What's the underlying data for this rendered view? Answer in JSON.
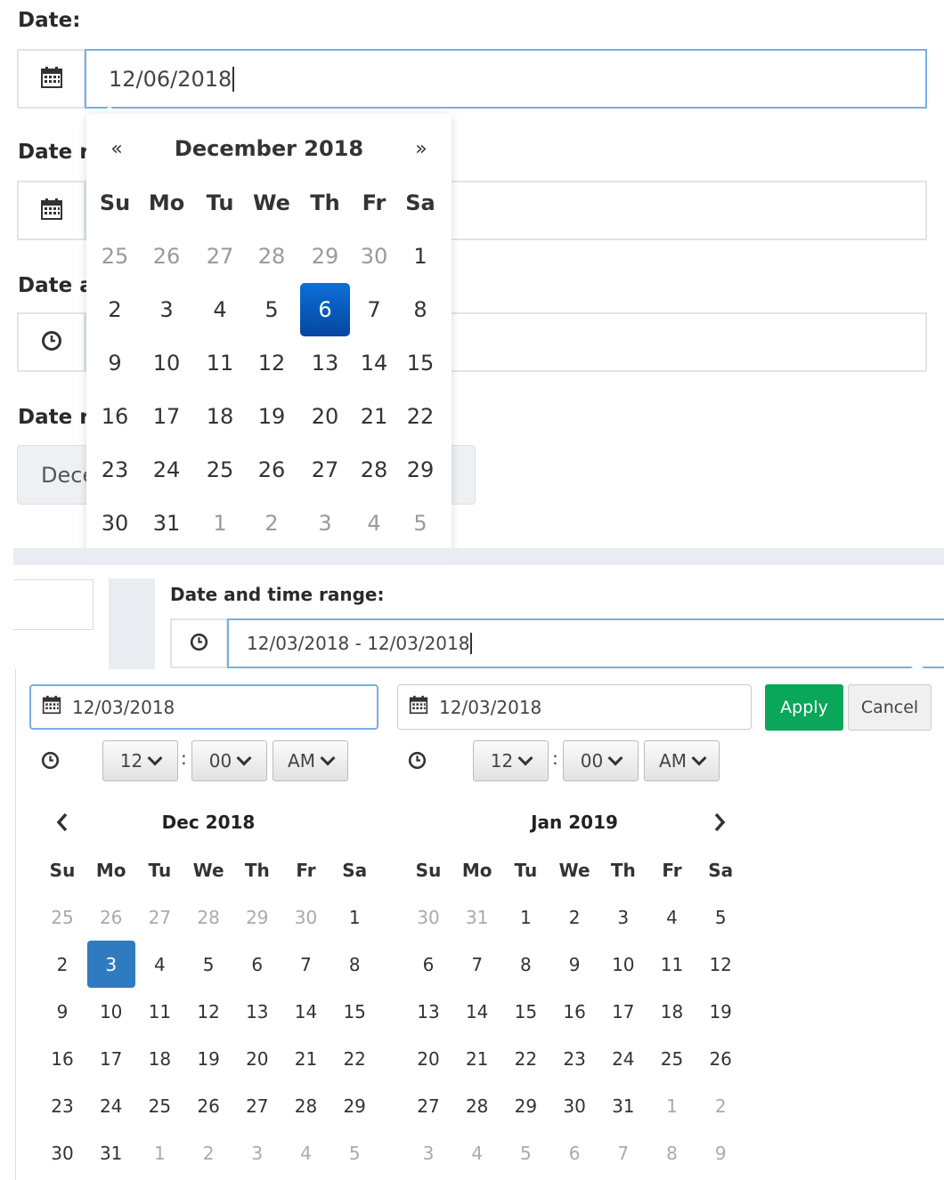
{
  "form": {
    "date_label": "Date:",
    "date_value": "12/06/2018",
    "date_range_label": "Date r",
    "date_and_label": "Date a",
    "date_range2_label": "Date r",
    "range_button_text": "Dece"
  },
  "datepicker": {
    "prev": "«",
    "next": "»",
    "title": "December 2018",
    "weekdays": [
      "Su",
      "Mo",
      "Tu",
      "We",
      "Th",
      "Fr",
      "Sa"
    ],
    "weeks": [
      [
        "25",
        "26",
        "27",
        "28",
        "29",
        "30",
        "1"
      ],
      [
        "2",
        "3",
        "4",
        "5",
        "6",
        "7",
        "8"
      ],
      [
        "9",
        "10",
        "11",
        "12",
        "13",
        "14",
        "15"
      ],
      [
        "16",
        "17",
        "18",
        "19",
        "20",
        "21",
        "22"
      ],
      [
        "23",
        "24",
        "25",
        "26",
        "27",
        "28",
        "29"
      ],
      [
        "30",
        "31",
        "1",
        "2",
        "3",
        "4",
        "5"
      ]
    ],
    "selected": "6"
  },
  "range": {
    "label": "Date and time range:",
    "value": "12/03/2018 - 12/03/2018",
    "start_input": "12/03/2018",
    "end_input": "12/03/2018",
    "apply": "Apply",
    "cancel": "Cancel",
    "time_separator": ":",
    "start_time": {
      "hour": "12",
      "minute": "00",
      "ampm": "AM"
    },
    "end_time": {
      "hour": "12",
      "minute": "00",
      "ampm": "AM"
    },
    "left_title": "Dec 2018",
    "right_title": "Jan 2019",
    "weekdays": [
      "Su",
      "Mo",
      "Tu",
      "We",
      "Th",
      "Fr",
      "Sa"
    ],
    "left_weeks": [
      [
        "25",
        "26",
        "27",
        "28",
        "29",
        "30",
        "1"
      ],
      [
        "2",
        "3",
        "4",
        "5",
        "6",
        "7",
        "8"
      ],
      [
        "9",
        "10",
        "11",
        "12",
        "13",
        "14",
        "15"
      ],
      [
        "16",
        "17",
        "18",
        "19",
        "20",
        "21",
        "22"
      ],
      [
        "23",
        "24",
        "25",
        "26",
        "27",
        "28",
        "29"
      ],
      [
        "30",
        "31",
        "1",
        "2",
        "3",
        "4",
        "5"
      ]
    ],
    "right_weeks": [
      [
        "30",
        "31",
        "1",
        "2",
        "3",
        "4",
        "5"
      ],
      [
        "6",
        "7",
        "8",
        "9",
        "10",
        "11",
        "12"
      ],
      [
        "13",
        "14",
        "15",
        "16",
        "17",
        "18",
        "19"
      ],
      [
        "20",
        "21",
        "22",
        "23",
        "24",
        "25",
        "26"
      ],
      [
        "27",
        "28",
        "29",
        "30",
        "31",
        "1",
        "2"
      ],
      [
        "3",
        "4",
        "5",
        "6",
        "7",
        "8",
        "9"
      ]
    ],
    "selected": "3"
  },
  "colors": {
    "accent": "#2f7bc2",
    "apply": "#0aa65a",
    "selected_top": "#0d6fd6"
  }
}
